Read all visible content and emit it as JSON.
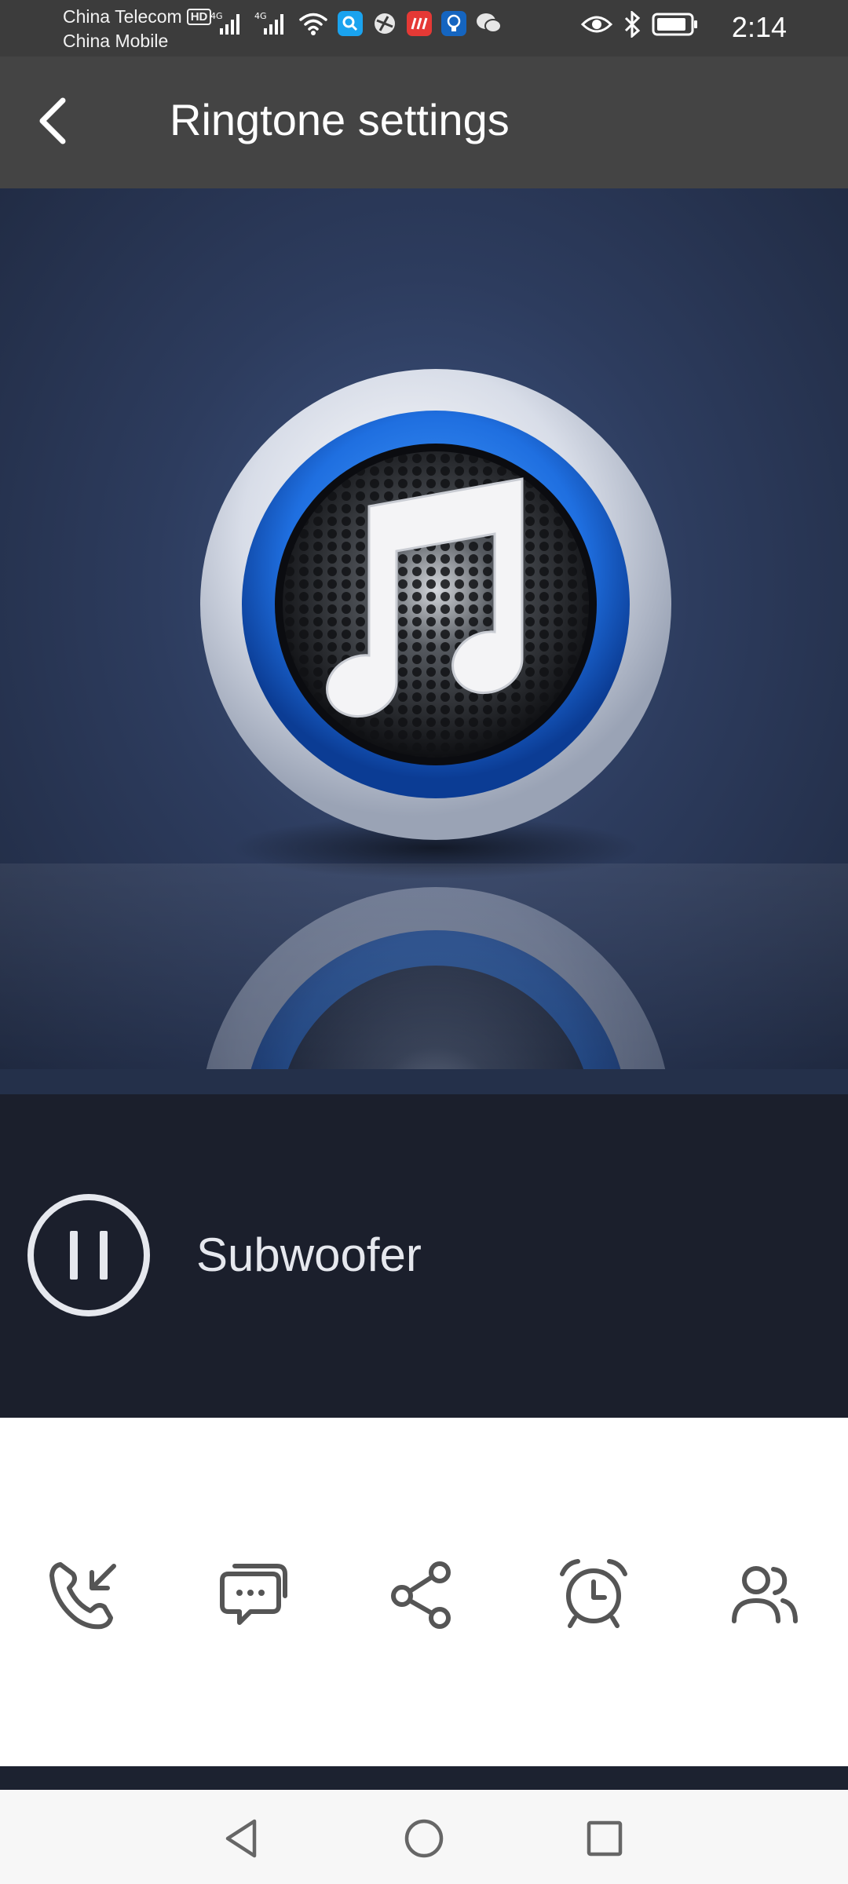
{
  "status_bar": {
    "carrier_1": "China Telecom",
    "carrier_2": "China Mobile",
    "hd_label": "HD",
    "net_1": "4G",
    "net_2": "4G",
    "time": "2:14",
    "icons": [
      "signal-icon",
      "signal-icon",
      "wifi-icon",
      "search-app-icon",
      "browser-app-icon",
      "news-app-icon",
      "bulb-app-icon",
      "wechat-icon",
      "eye-icon",
      "bluetooth-icon",
      "battery-icon"
    ]
  },
  "header": {
    "title": "Ringtone settings",
    "back_icon": "chevron-left-icon"
  },
  "player": {
    "track_name": "Subwoofer",
    "state_icon": "pause-icon"
  },
  "actions": [
    {
      "name": "set-call-ringtone",
      "icon": "incoming-call-icon"
    },
    {
      "name": "set-message-tone",
      "icon": "message-icon"
    },
    {
      "name": "share",
      "icon": "share-icon"
    },
    {
      "name": "set-alarm",
      "icon": "alarm-icon"
    },
    {
      "name": "set-contact-ringtone",
      "icon": "contacts-icon"
    }
  ],
  "nav": {
    "icons": [
      "back-triangle-icon",
      "home-circle-icon",
      "recents-square-icon"
    ]
  },
  "colors": {
    "header_bg": "#444444",
    "status_bg": "#3c3c3c",
    "player_bg": "#1b1f2c",
    "accent_blue": "#1f6fe0",
    "icon_gray": "#555555"
  }
}
